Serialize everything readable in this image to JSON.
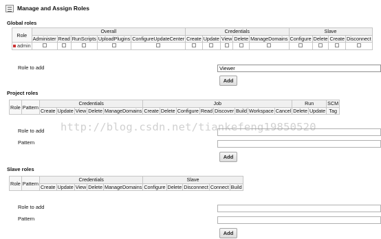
{
  "page": {
    "title": "Manage and Assign Roles"
  },
  "global_roles": {
    "title": "Global roles",
    "role_header": "Role",
    "groups": [
      "Overall",
      "Credentials",
      "Slave"
    ],
    "overall_permissions": [
      "Administer",
      "Read",
      "RunScripts",
      "UploadPlugins",
      "ConfigureUpdateCenter"
    ],
    "credentials_permissions": [
      "Create",
      "Update",
      "View",
      "Delete",
      "ManageDomains"
    ],
    "slave_permissions": [
      "Configure",
      "Delete",
      "Create",
      "Disconnect"
    ],
    "rows": [
      {
        "role": "admin"
      }
    ],
    "role_to_add_label": "Role to add",
    "role_to_add_value": "Viewer",
    "add_label": "Add"
  },
  "project_roles": {
    "title": "Project roles",
    "role_header": "Role",
    "pattern_header": "Pattern",
    "groups": [
      "Credentials",
      "Job",
      "Run",
      "SCM"
    ],
    "credentials_permissions": [
      "Create",
      "Update",
      "View",
      "Delete",
      "ManageDomains"
    ],
    "job_permissions": [
      "Create",
      "Delete",
      "Configure",
      "Read",
      "Discover",
      "Build",
      "Workspace",
      "Cancel"
    ],
    "run_permissions": [
      "Delete",
      "Update"
    ],
    "scm_permissions": [
      "Tag"
    ],
    "role_to_add_label": "Role to add",
    "pattern_label": "Pattern",
    "add_label": "Add"
  },
  "slave_roles": {
    "title": "Slave roles",
    "role_header": "Role",
    "pattern_header": "Pattern",
    "groups": [
      "Credentials",
      "Slave"
    ],
    "credentials_permissions": [
      "Create",
      "Update",
      "View",
      "Delete",
      "ManageDomains"
    ],
    "slave_permissions": [
      "Configure",
      "Delete",
      "Disconnect",
      "Connect",
      "Build"
    ],
    "role_to_add_label": "Role to add",
    "pattern_label": "Pattern",
    "add_label": "Add"
  },
  "watermark": "http://blog.csdn.net/tiankefeng19850520"
}
